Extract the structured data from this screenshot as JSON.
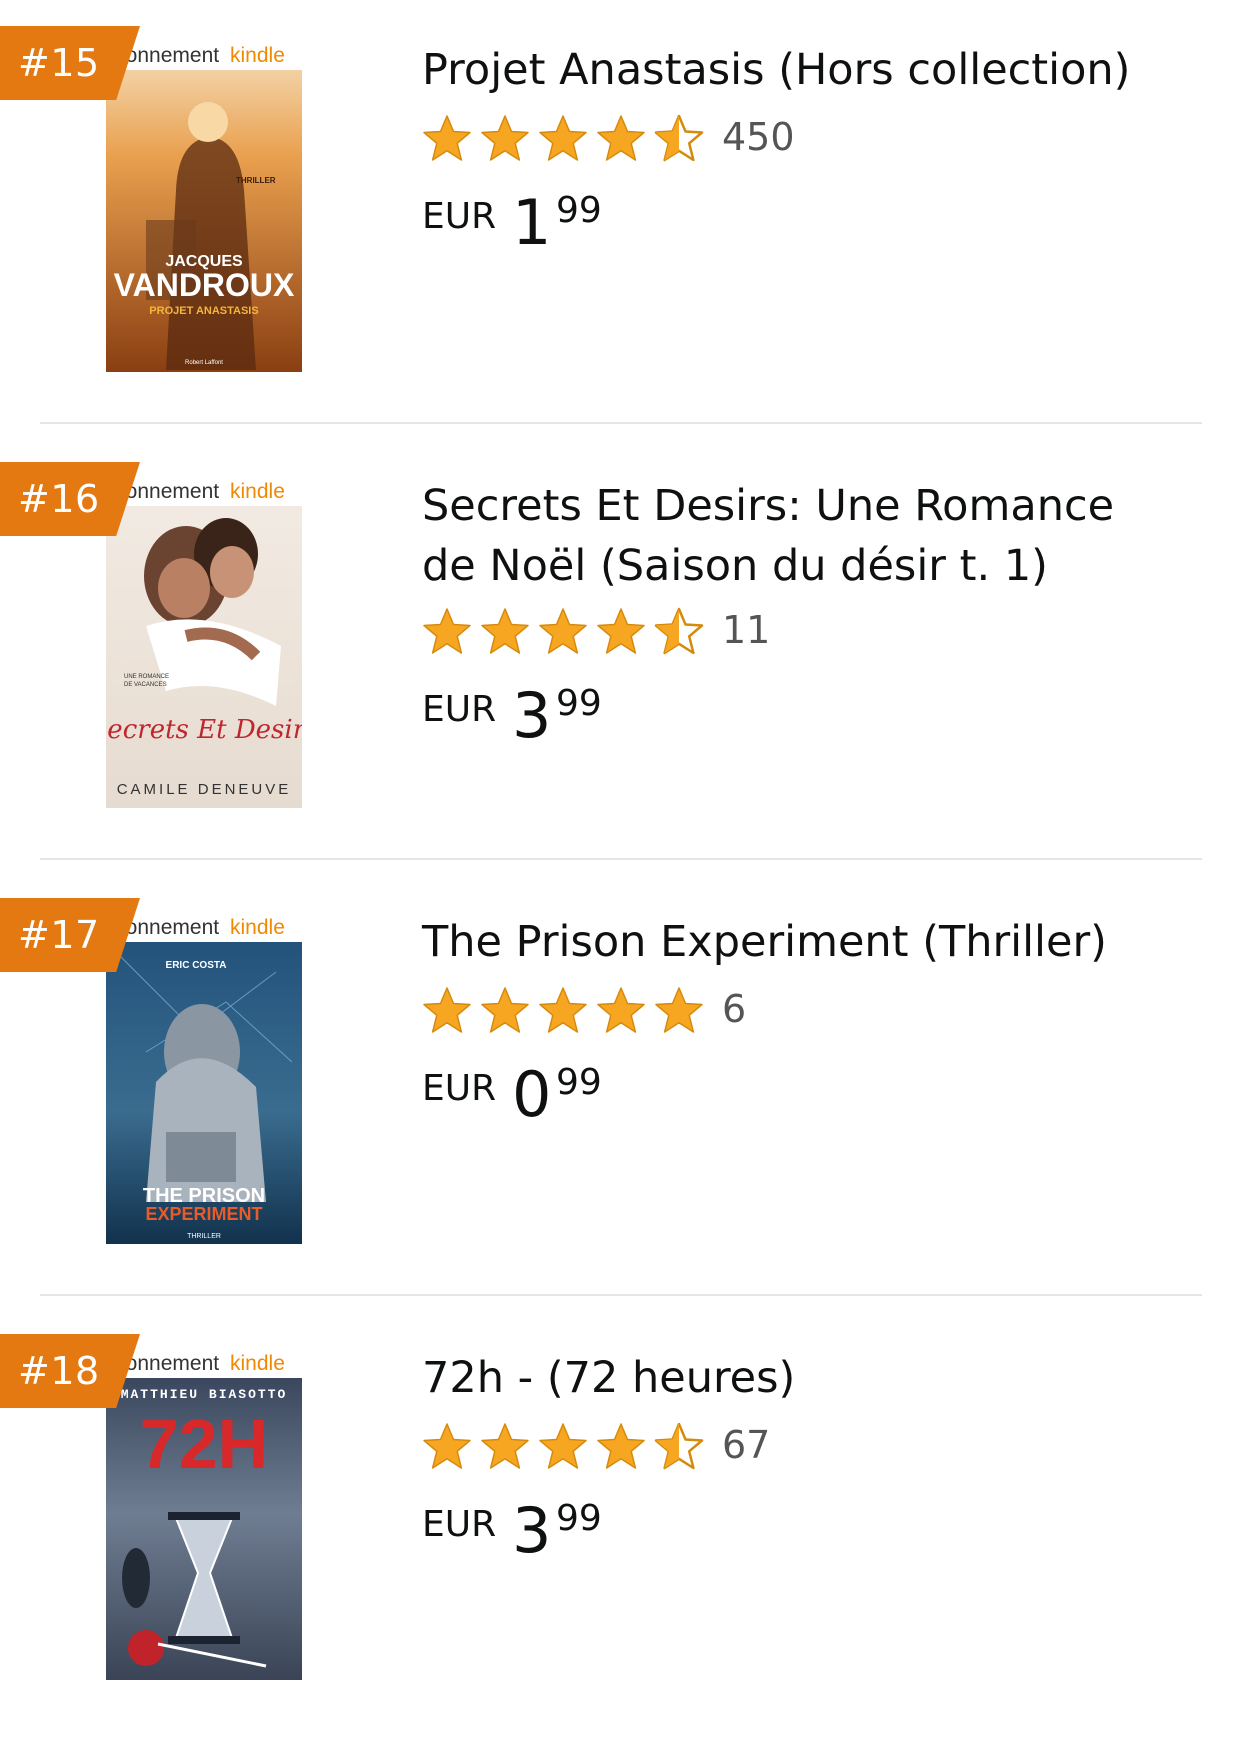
{
  "colors": {
    "rank_badge": "#e47911",
    "star": "#f7a621",
    "divider": "#e3e6e6"
  },
  "items": [
    {
      "rank": "#15",
      "cover": {
        "banner_prefix": "bonnement",
        "banner_brand": "kindle",
        "genre": "THRILLER",
        "author_top": "JACQUES",
        "author_bottom": "VANDROUX",
        "book_title": "PROJET ANASTASIS",
        "publisher": "Robert Laffont"
      },
      "title": "Projet Anastasis (Hors collection)",
      "rating": 4.5,
      "stars_icons": [
        "star-full-icon",
        "star-full-icon",
        "star-full-icon",
        "star-full-icon",
        "star-half-icon"
      ],
      "review_count": "450",
      "price": {
        "currency": "EUR",
        "whole": "1",
        "fraction": "99"
      }
    },
    {
      "rank": "#16",
      "cover": {
        "banner_prefix": "bonnement",
        "banner_brand": "kindle",
        "tagline_1": "UNE ROMANCE",
        "tagline_2": "DE VACANCES",
        "book_title": "Secrets Et Desirs",
        "author": "CAMILE DENEUVE"
      },
      "title": "Secrets Et Desirs: Une Romance de Noël (Saison du désir t. 1)",
      "rating": 4.5,
      "stars_icons": [
        "star-full-icon",
        "star-full-icon",
        "star-full-icon",
        "star-full-icon",
        "star-half-icon"
      ],
      "review_count": "11",
      "price": {
        "currency": "EUR",
        "whole": "3",
        "fraction": "99"
      }
    },
    {
      "rank": "#17",
      "cover": {
        "banner_prefix": "bonnement",
        "banner_brand": "kindle",
        "author": "ERIC COSTA",
        "title_1": "THE PRISON",
        "title_2": "EXPERIMENT",
        "genre": "THRILLER"
      },
      "title": "The Prison Experiment (Thriller)",
      "rating": 5,
      "stars_icons": [
        "star-full-icon",
        "star-full-icon",
        "star-full-icon",
        "star-full-icon",
        "star-full-icon"
      ],
      "review_count": "6",
      "price": {
        "currency": "EUR",
        "whole": "0",
        "fraction": "99"
      }
    },
    {
      "rank": "#18",
      "cover": {
        "banner_prefix": "bonnement",
        "banner_brand": "kindle",
        "author": "MATTHIEU BIASOTTO",
        "book_title": "72H"
      },
      "title": "72h - (72 heures)",
      "rating": 4.5,
      "stars_icons": [
        "star-full-icon",
        "star-full-icon",
        "star-full-icon",
        "star-full-icon",
        "star-half-icon"
      ],
      "review_count": "67",
      "price": {
        "currency": "EUR",
        "whole": "3",
        "fraction": "99"
      }
    }
  ]
}
